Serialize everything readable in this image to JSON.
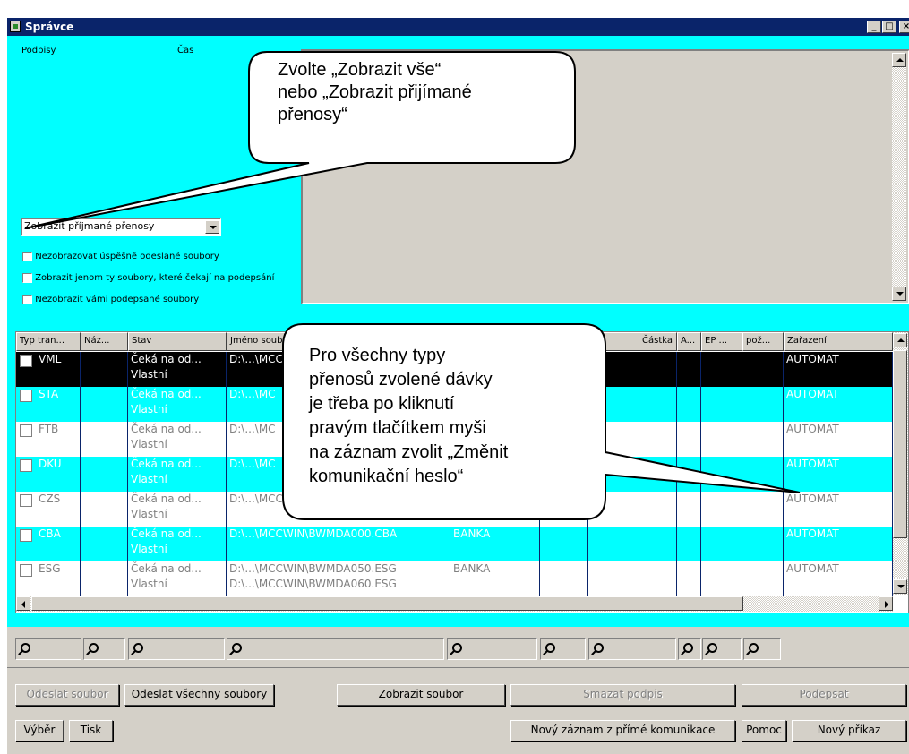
{
  "window": {
    "title": "Správce",
    "min": "_",
    "max": "□",
    "close": "×"
  },
  "top": {
    "col_podpisy": "Podpisy",
    "col_cas": "Čas",
    "combo_value": "Zobrazit příjmané přenosy",
    "checks": [
      "Nezobrazovat úspěšně odeslané soubory",
      "Zobrazit jenom ty soubory, které čekají na podepsání",
      "Nezobrazit vámi podepsané soubory"
    ]
  },
  "callout1": {
    "lines": [
      "Zvolte „Zobrazit vše“",
      "nebo „Zobrazit přijímané",
      "přenosy“"
    ]
  },
  "callout2": {
    "lines": [
      "Pro všechny typy",
      "přenosů zvolené dávky",
      "je třeba po kliknutí",
      "pravým tlačítkem myši",
      "na záznam zvolit „Změnit",
      "komunikační heslo“"
    ]
  },
  "grid": {
    "headers": [
      "Typ tran...",
      "Náz...",
      "Stav",
      "Jméno soub",
      "",
      "",
      "Částka",
      "A...",
      "EP ...",
      "pož...",
      "Zařazení"
    ],
    "rows": [
      {
        "type": "VML",
        "stav1": "Čeká na od...",
        "stav2": "Vlastní",
        "file": "D:\\...\\MCC",
        "file2": "",
        "bank": "",
        "zar": "AUTOMAT"
      },
      {
        "type": "STA",
        "stav1": "Čeká na od...",
        "stav2": "Vlastní",
        "file": "D:\\...\\MC",
        "file2": "",
        "bank": "",
        "zar": "AUTOMAT"
      },
      {
        "type": "FTB",
        "stav1": "Čeká na od...",
        "stav2": "Vlastní",
        "file": "D:\\...\\MC",
        "file2": "",
        "bank": "",
        "zar": "AUTOMAT"
      },
      {
        "type": "DKU",
        "stav1": "Čeká na od...",
        "stav2": "Vlastní",
        "file": "D:\\...\\MC",
        "file2": "",
        "bank": "",
        "zar": "AUTOMAT"
      },
      {
        "type": "CZS",
        "stav1": "Čeká na od...",
        "stav2": "Vlastní",
        "file": "D:\\...\\MCC",
        "file2": "",
        "bank": "",
        "zar": "AUTOMAT"
      },
      {
        "type": "CBA",
        "stav1": "Čeká na od...",
        "stav2": "Vlastní",
        "file": "D:\\...\\MCCWIN\\BWMDA000.CBA",
        "file2": "",
        "bank": "BANKA",
        "zar": "AUTOMAT"
      },
      {
        "type": "ESG",
        "stav1": "Čeká na od...",
        "stav2": "Vlastní",
        "file": "D:\\...\\MCCWIN\\BWMDA050.ESG",
        "file2": "D:\\...\\MCCWIN\\BWMDA060.ESG",
        "bank": "BANKA",
        "zar": "AUTOMAT"
      }
    ]
  },
  "buttons": {
    "odeslat_soubor": "Odeslat soubor",
    "odeslat_vse": "Odeslat všechny soubory",
    "zobrazit_soubor": "Zobrazit soubor",
    "smazat_podpis": "Smazat podpis",
    "podepsat": "Podepsat",
    "vyber": "Výběr",
    "tisk": "Tisk",
    "novy_zaznam": "Nový záznam z přímé komunikace",
    "pomoc": "Pomoc",
    "novy_prikaz": "Nový příkaz"
  },
  "colors": {
    "cyan": "#00ffff",
    "titlebar": "#0a246a",
    "selected_row": "#000000"
  }
}
